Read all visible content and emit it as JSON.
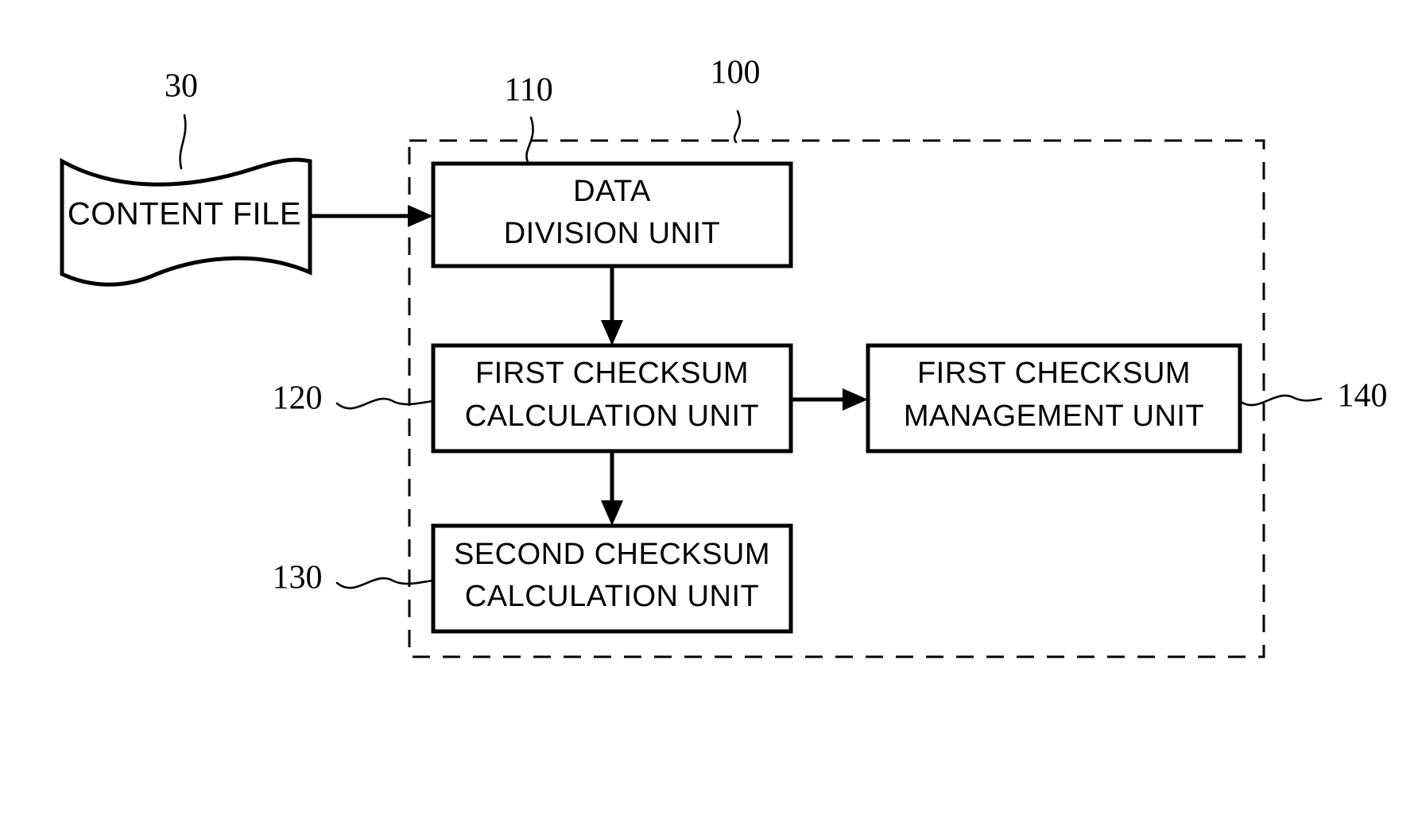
{
  "figure": {
    "title": "Content file checksum processing block diagram",
    "background_color": "#ffffff",
    "line_color": "#000000"
  },
  "source": {
    "ref": "30",
    "label": "CONTENT FILE",
    "shape": "wavy-document"
  },
  "container": {
    "ref": "100",
    "style": "dashed"
  },
  "blocks": [
    {
      "ref": "110",
      "line1": "DATA",
      "line2": "DIVISION UNIT",
      "ref_position": "above"
    },
    {
      "ref": "120",
      "line1": "FIRST CHECKSUM",
      "line2": "CALCULATION UNIT",
      "ref_position": "left"
    },
    {
      "ref": "130",
      "line1": "SECOND CHECKSUM",
      "line2": "CALCULATION UNIT",
      "ref_position": "left"
    },
    {
      "ref": "140",
      "line1": "FIRST CHECKSUM",
      "line2": "MANAGEMENT UNIT",
      "ref_position": "right"
    }
  ],
  "connections": [
    {
      "from": "CONTENT FILE",
      "to": "DATA DIVISION UNIT",
      "direction": "right"
    },
    {
      "from": "DATA DIVISION UNIT",
      "to": "FIRST CHECKSUM CALCULATION UNIT",
      "direction": "down"
    },
    {
      "from": "FIRST CHECKSUM CALCULATION UNIT",
      "to": "SECOND CHECKSUM CALCULATION UNIT",
      "direction": "down"
    },
    {
      "from": "FIRST CHECKSUM CALCULATION UNIT",
      "to": "FIRST CHECKSUM MANAGEMENT UNIT",
      "direction": "right"
    }
  ]
}
